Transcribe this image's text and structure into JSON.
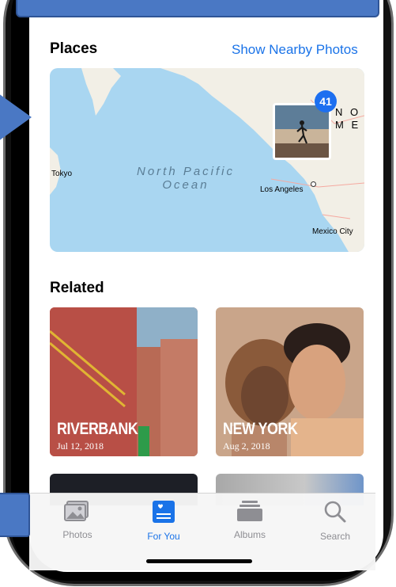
{
  "places": {
    "title": "Places",
    "show_nearby": "Show Nearby Photos",
    "map": {
      "labels": {
        "tokyo": "Tokyo",
        "ocean_line1": "North Pacific",
        "ocean_line2": "Ocean",
        "los_angeles": "Los Angeles",
        "mexico_city": "Mexico City",
        "noname": "N O",
        "me": "M E"
      },
      "badge_count": "41"
    }
  },
  "related": {
    "title": "Related",
    "cards": [
      {
        "title": "RIVERBANK",
        "date": "Jul 12, 2018"
      },
      {
        "title": "NEW YORK",
        "date": "Aug 2, 2018"
      }
    ]
  },
  "tabbar": {
    "tabs": [
      {
        "label": "Photos",
        "icon": "photos-icon"
      },
      {
        "label": "For You",
        "icon": "for-you-icon",
        "active": true
      },
      {
        "label": "Albums",
        "icon": "albums-icon"
      },
      {
        "label": "Search",
        "icon": "search-icon"
      }
    ]
  },
  "colors": {
    "accent": "#1a73e8",
    "map_water": "#a9d6f1",
    "map_land": "#f2efe6",
    "callout": "#4a78c4"
  }
}
